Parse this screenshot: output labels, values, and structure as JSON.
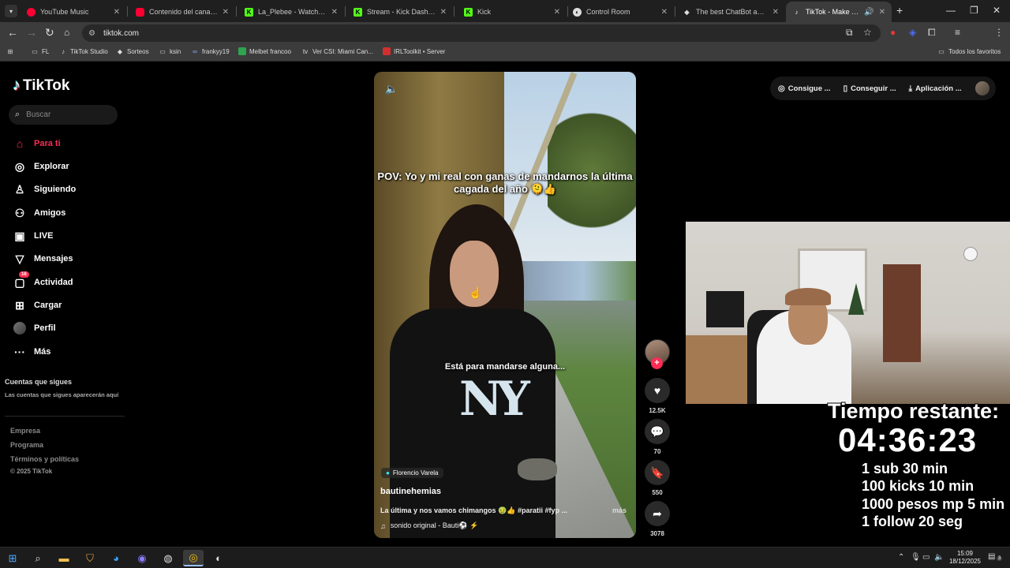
{
  "browser": {
    "tabs": [
      {
        "label": "YouTube Music",
        "icon": "youtube-music-icon",
        "color": "#ff0033"
      },
      {
        "label": "Contenido del canal - You",
        "icon": "youtube-icon",
        "color": "#ff0033"
      },
      {
        "label": "La_Plebee - Watch the VOD",
        "icon": "kick-icon",
        "color": "#53fc18"
      },
      {
        "label": "Stream - Kick Dashboard",
        "icon": "kick-icon",
        "color": "#53fc18"
      },
      {
        "label": "Kick",
        "icon": "kick-icon",
        "color": "#53fc18"
      },
      {
        "label": "Control Room",
        "icon": "control-room-icon",
        "color": "#dddddd"
      },
      {
        "label": "The best ChatBot and Wi",
        "icon": "chatbot-icon",
        "color": "#dddddd"
      },
      {
        "label": "TikTok - Make Your Day",
        "icon": "tiktok-icon",
        "color": "#ffffff"
      }
    ],
    "url": "tiktok.com",
    "bookmarks": [
      {
        "label": "FL",
        "icon": "folder-icon"
      },
      {
        "label": "TikTok Studio",
        "icon": "tiktok-icon"
      },
      {
        "label": "Sorteos",
        "icon": "diamond-icon"
      },
      {
        "label": "ksin",
        "icon": "folder-icon"
      },
      {
        "label": "frankyy19",
        "icon": "link-icon"
      },
      {
        "label": "Melbet francoo",
        "icon": "melbet-icon"
      },
      {
        "label": "Ver CSI: Miami Can...",
        "icon": "tv-icon"
      },
      {
        "label": "IRLToolkit • Server",
        "icon": "irltoolkit-icon"
      }
    ],
    "all_bookmarks": "Todos los favoritos"
  },
  "tiktok": {
    "logo": "TikTok",
    "search_placeholder": "Buscar",
    "nav": [
      {
        "label": "Para ti",
        "icon": "home-icon"
      },
      {
        "label": "Explorar",
        "icon": "compass-icon"
      },
      {
        "label": "Siguiendo",
        "icon": "following-icon"
      },
      {
        "label": "Amigos",
        "icon": "friends-icon"
      },
      {
        "label": "LIVE",
        "icon": "live-icon"
      },
      {
        "label": "Mensajes",
        "icon": "messages-icon"
      },
      {
        "label": "Actividad",
        "icon": "activity-icon",
        "badge": "16"
      },
      {
        "label": "Cargar",
        "icon": "upload-icon"
      },
      {
        "label": "Perfil",
        "icon": "profile-avatar"
      },
      {
        "label": "Más",
        "icon": "more-icon"
      }
    ],
    "following_title": "Cuentas que sigues",
    "following_desc": "Las cuentas que sigues aparecerán aquí",
    "footer": [
      "Empresa",
      "Programa",
      "Términos y políticas"
    ],
    "copyright": "© 2025 TikTok",
    "topbar": [
      "Consigue ...",
      "Conseguir ...",
      "Aplicación ..."
    ],
    "video": {
      "caption_top": "POV: Yo y mi real con ganas de mandarnos la última cagada del año 🫠👍",
      "caption_mid": "Está para mandarse alguna...",
      "location": "Florencio Varela",
      "author": "bautinehemias",
      "description": "La última y nos vamos chimangos 🤢👍 #paratii #fyp ...",
      "more": "más",
      "music": "sonido original - Bauti⚽ ⚡"
    },
    "actions": {
      "likes": "12.5K",
      "comments": "70",
      "saves": "550",
      "shares": "3078"
    }
  },
  "overlay": {
    "title": "Tiempo restante:",
    "timer": "04:36:23",
    "lines": [
      "1 sub 30 min",
      "100 kicks 10 min",
      "1000 pesos mp 5 min",
      "1 follow 20 seg"
    ]
  },
  "taskbar": {
    "time": "15:09",
    "date": "18/12/2025",
    "notifications": "3"
  }
}
